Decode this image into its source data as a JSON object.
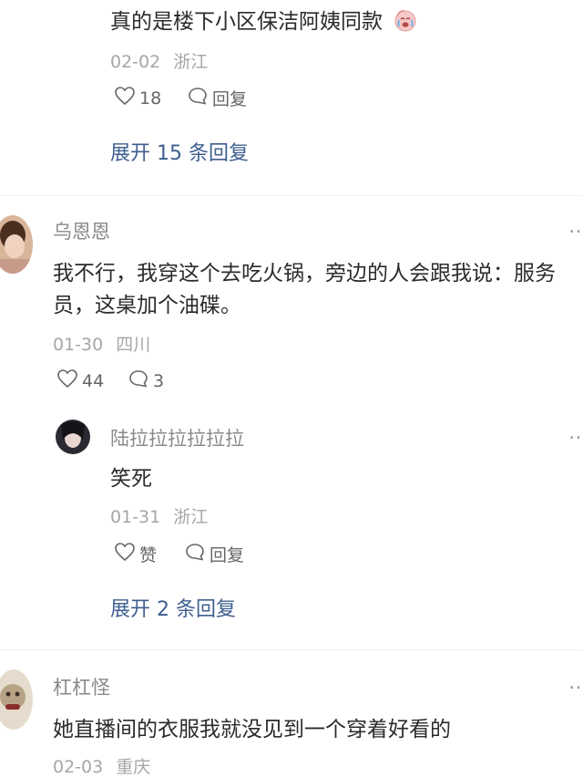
{
  "comment1": {
    "text": "真的是楼下小区保洁阿姨同款",
    "emoji": "crying-face-icon",
    "date": "02-02",
    "location": "浙江",
    "likes": "18",
    "reply_label": "回复",
    "expand": "展开 15 条回复"
  },
  "comment2": {
    "username": "乌恩恩",
    "text_line1": "我不行，我穿这个去吃火锅，旁边的人会跟我说：服务",
    "text_line2": "员，这桌加个油碟。",
    "date": "01-30",
    "location": "四川",
    "likes": "44",
    "comments": "3"
  },
  "reply": {
    "username": "陆拉拉拉拉拉拉",
    "text": "笑死",
    "date": "01-31",
    "location": "浙江",
    "like_label": "赞",
    "reply_label": "回复",
    "expand": "展开 2 条回复"
  },
  "comment3": {
    "username": "杠杠怪",
    "text": "她直播间的衣服我就没见到一个穿着好看的",
    "date": "02-03",
    "location": "重庆"
  },
  "more_label": "…"
}
